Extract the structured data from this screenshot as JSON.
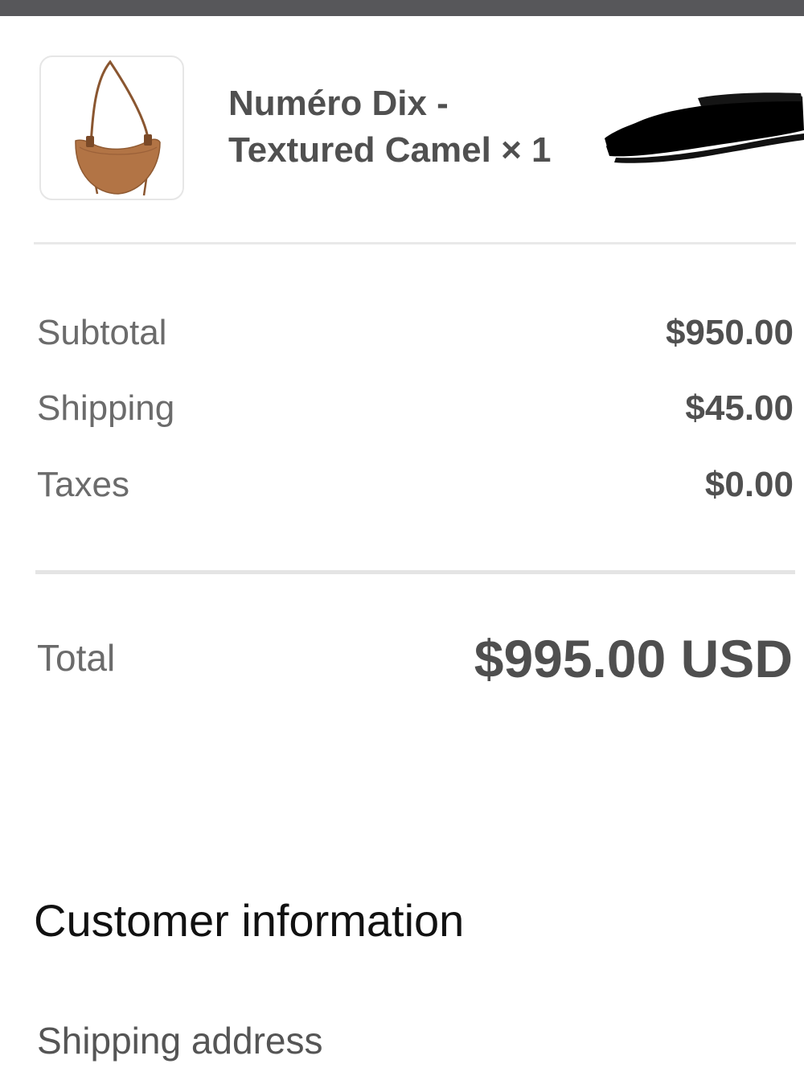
{
  "product": {
    "name_line1": "Numéro Dix -",
    "name_line2": "Textured Camel × 1",
    "image_icon": "handbag-icon",
    "bag_color": "#b27445"
  },
  "summary": {
    "subtotal_label": "Subtotal",
    "subtotal_value": "$950.00",
    "shipping_label": "Shipping",
    "shipping_value": "$45.00",
    "taxes_label": "Taxes",
    "taxes_value": "$0.00"
  },
  "total": {
    "label": "Total",
    "value": "$995.00 USD"
  },
  "customer": {
    "section_title": "Customer information",
    "shipping_address_label": "Shipping address"
  },
  "colors": {
    "top_bar": "#57575a",
    "redaction": "#000000"
  }
}
